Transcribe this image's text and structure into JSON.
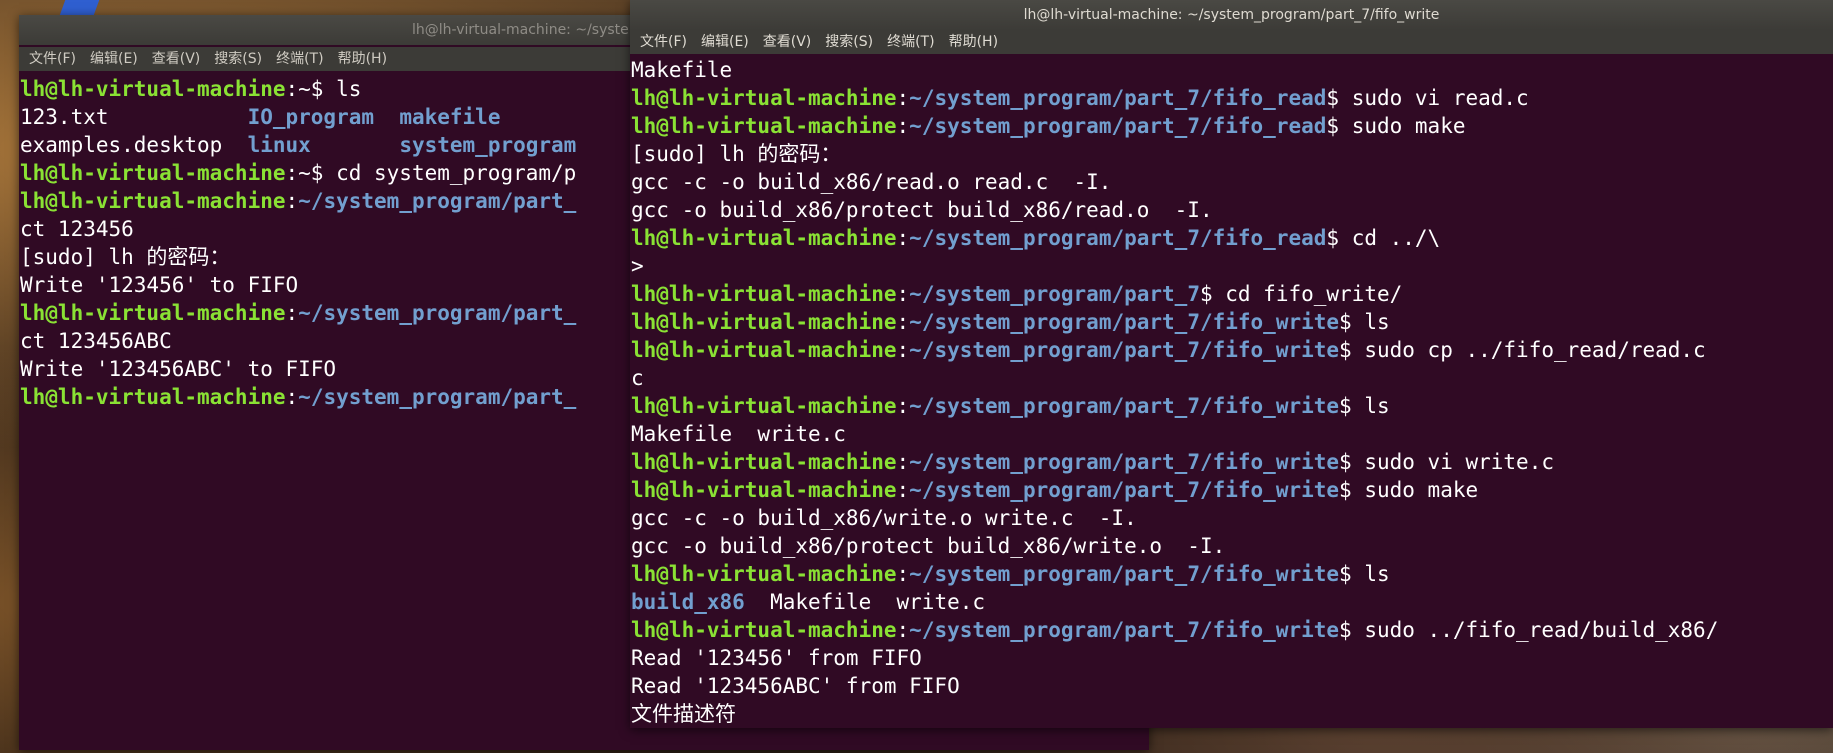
{
  "left_window": {
    "title": "lh@lh-virtual-machine: ~/syste",
    "menu": [
      "文件(F)",
      "编辑(E)",
      "查看(V)",
      "搜索(S)",
      "终端(T)",
      "帮助(H)"
    ],
    "lines": [
      [
        {
          "c": "u",
          "t": "lh@lh-virtual-machine"
        },
        {
          "c": "t",
          "t": ":~$ ls"
        }
      ],
      [
        {
          "c": "t",
          "t": "123.txt           "
        },
        {
          "c": "d",
          "t": "IO_program"
        },
        {
          "c": "t",
          "t": "  "
        },
        {
          "c": "d",
          "t": "makefile"
        }
      ],
      [
        {
          "c": "t",
          "t": "examples.desktop  "
        },
        {
          "c": "d",
          "t": "linux"
        },
        {
          "c": "t",
          "t": "       "
        },
        {
          "c": "d",
          "t": "system_program"
        }
      ],
      [
        {
          "c": "u",
          "t": "lh@lh-virtual-machine"
        },
        {
          "c": "t",
          "t": ":~$ cd system_program/p"
        }
      ],
      [
        {
          "c": "u",
          "t": "lh@lh-virtual-machine"
        },
        {
          "c": "t",
          "t": ":"
        },
        {
          "c": "p",
          "t": "~/system_program/part_"
        }
      ],
      [
        {
          "c": "t",
          "t": "ct 123456"
        }
      ],
      [
        {
          "c": "t",
          "t": "[sudo] lh 的密码："
        }
      ],
      [
        {
          "c": "t",
          "t": "Write '123456' to FIFO"
        }
      ],
      [
        {
          "c": "u",
          "t": "lh@lh-virtual-machine"
        },
        {
          "c": "t",
          "t": ":"
        },
        {
          "c": "p",
          "t": "~/system_program/part_"
        }
      ],
      [
        {
          "c": "t",
          "t": "ct 123456ABC"
        }
      ],
      [
        {
          "c": "t",
          "t": "Write '123456ABC' to FIFO"
        }
      ],
      [
        {
          "c": "u",
          "t": "lh@lh-virtual-machine"
        },
        {
          "c": "t",
          "t": ":"
        },
        {
          "c": "p",
          "t": "~/system_program/part_"
        }
      ]
    ]
  },
  "right_window": {
    "title": "lh@lh-virtual-machine: ~/system_program/part_7/fifo_write",
    "menu": [
      "文件(F)",
      "编辑(E)",
      "查看(V)",
      "搜索(S)",
      "终端(T)",
      "帮助(H)"
    ],
    "lines": [
      [
        {
          "c": "t",
          "t": "Makefile"
        }
      ],
      [
        {
          "c": "u",
          "t": "lh@lh-virtual-machine"
        },
        {
          "c": "t",
          "t": ":"
        },
        {
          "c": "p",
          "t": "~/system_program/part_7/fifo_read"
        },
        {
          "c": "t",
          "t": "$ sudo vi read.c"
        }
      ],
      [
        {
          "c": "u",
          "t": "lh@lh-virtual-machine"
        },
        {
          "c": "t",
          "t": ":"
        },
        {
          "c": "p",
          "t": "~/system_program/part_7/fifo_read"
        },
        {
          "c": "t",
          "t": "$ sudo make"
        }
      ],
      [
        {
          "c": "t",
          "t": "[sudo] lh 的密码："
        }
      ],
      [
        {
          "c": "t",
          "t": "gcc -c -o build_x86/read.o read.c  -I."
        }
      ],
      [
        {
          "c": "t",
          "t": "gcc -o build_x86/protect build_x86/read.o  -I."
        }
      ],
      [
        {
          "c": "u",
          "t": "lh@lh-virtual-machine"
        },
        {
          "c": "t",
          "t": ":"
        },
        {
          "c": "p",
          "t": "~/system_program/part_7/fifo_read"
        },
        {
          "c": "t",
          "t": "$ cd ../\\"
        }
      ],
      [
        {
          "c": "t",
          "t": ">"
        }
      ],
      [
        {
          "c": "u",
          "t": "lh@lh-virtual-machine"
        },
        {
          "c": "t",
          "t": ":"
        },
        {
          "c": "p",
          "t": "~/system_program/part_7"
        },
        {
          "c": "t",
          "t": "$ cd fifo_write/"
        }
      ],
      [
        {
          "c": "u",
          "t": "lh@lh-virtual-machine"
        },
        {
          "c": "t",
          "t": ":"
        },
        {
          "c": "p",
          "t": "~/system_program/part_7/fifo_write"
        },
        {
          "c": "t",
          "t": "$ ls"
        }
      ],
      [
        {
          "c": "u",
          "t": "lh@lh-virtual-machine"
        },
        {
          "c": "t",
          "t": ":"
        },
        {
          "c": "p",
          "t": "~/system_program/part_7/fifo_write"
        },
        {
          "c": "t",
          "t": "$ sudo cp ../fifo_read/read.c"
        }
      ],
      [
        {
          "c": "t",
          "t": "c"
        }
      ],
      [
        {
          "c": "u",
          "t": "lh@lh-virtual-machine"
        },
        {
          "c": "t",
          "t": ":"
        },
        {
          "c": "p",
          "t": "~/system_program/part_7/fifo_write"
        },
        {
          "c": "t",
          "t": "$ ls"
        }
      ],
      [
        {
          "c": "t",
          "t": "Makefile  write.c"
        }
      ],
      [
        {
          "c": "u",
          "t": "lh@lh-virtual-machine"
        },
        {
          "c": "t",
          "t": ":"
        },
        {
          "c": "p",
          "t": "~/system_program/part_7/fifo_write"
        },
        {
          "c": "t",
          "t": "$ sudo vi write.c"
        }
      ],
      [
        {
          "c": "u",
          "t": "lh@lh-virtual-machine"
        },
        {
          "c": "t",
          "t": ":"
        },
        {
          "c": "p",
          "t": "~/system_program/part_7/fifo_write"
        },
        {
          "c": "t",
          "t": "$ sudo make"
        }
      ],
      [
        {
          "c": "t",
          "t": "gcc -c -o build_x86/write.o write.c  -I."
        }
      ],
      [
        {
          "c": "t",
          "t": "gcc -o build_x86/protect build_x86/write.o  -I."
        }
      ],
      [
        {
          "c": "u",
          "t": "lh@lh-virtual-machine"
        },
        {
          "c": "t",
          "t": ":"
        },
        {
          "c": "p",
          "t": "~/system_program/part_7/fifo_write"
        },
        {
          "c": "t",
          "t": "$ ls"
        }
      ],
      [
        {
          "c": "d",
          "t": "build_x86"
        },
        {
          "c": "t",
          "t": "  Makefile  write.c"
        }
      ],
      [
        {
          "c": "u",
          "t": "lh@lh-virtual-machine"
        },
        {
          "c": "t",
          "t": ":"
        },
        {
          "c": "p",
          "t": "~/system_program/part_7/fifo_write"
        },
        {
          "c": "t",
          "t": "$ sudo ../fifo_read/build_x86/"
        }
      ],
      [
        {
          "c": "t",
          "t": "Read '123456' from FIFO"
        }
      ],
      [
        {
          "c": "t",
          "t": "Read '123456ABC' from FIFO"
        }
      ],
      [
        {
          "c": "t",
          "t": "文件描述符"
        }
      ]
    ]
  },
  "colors": {
    "terminal_bg": "#300a24",
    "prompt_user": "#8ae234",
    "prompt_path": "#729fcf",
    "text": "#ffffff",
    "titlebar": "#3c3b37"
  }
}
